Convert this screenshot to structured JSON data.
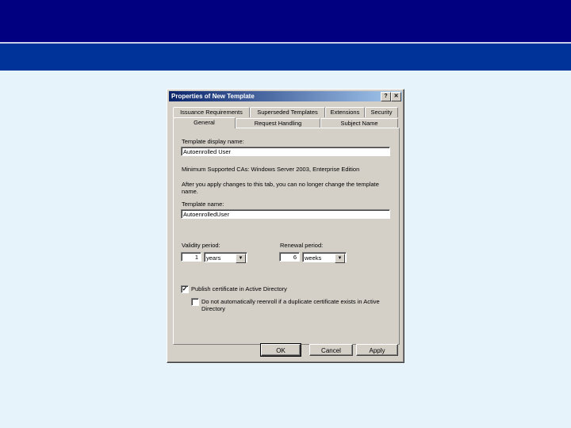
{
  "dialog": {
    "title": "Properties of New Template",
    "help_icon": "?",
    "close_icon": "✕",
    "tabs_row1": [
      "Issuance Requirements",
      "Superseded Templates",
      "Extensions",
      "Security"
    ],
    "tabs_row2": [
      "General",
      "Request Handling",
      "Subject Name"
    ],
    "active_tab": "General",
    "display_name_label": "Template display name:",
    "display_name_value": "Autoenrolled User",
    "min_ca_text": "Minimum Supported CAs:  Windows Server 2003, Enterprise Edition",
    "warning_text": "After you apply changes to this tab, you can no longer change the template",
    "warning_text_2": "name.",
    "template_name_label": "Template name:",
    "template_name_value": "AutoenrolledUser",
    "validity_label": "Validity period:",
    "validity_value": "1",
    "validity_unit": "years",
    "renewal_label": "Renewal period:",
    "renewal_value": "6",
    "renewal_unit": "weeks",
    "publish_label": "Publish certificate in Active Directory",
    "publish_checked": "✓",
    "reenroll_label": "Do not automatically reenroll if a duplicate certificate exists in Active",
    "reenroll_label_2": "Directory",
    "ok": "OK",
    "cancel": "Cancel",
    "apply": "Apply",
    "dropdown_icon": "▼"
  }
}
